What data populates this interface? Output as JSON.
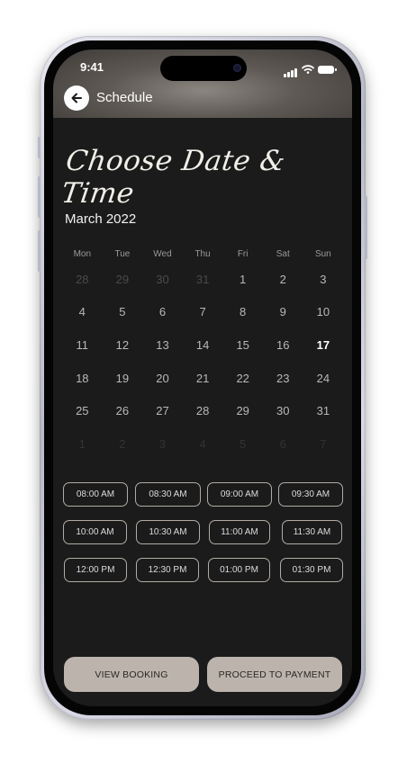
{
  "status_bar": {
    "time": "9:41"
  },
  "header": {
    "title": "Schedule",
    "back_icon": "arrow-left-icon"
  },
  "page_title": "Choose Date & Time",
  "calendar": {
    "month": "March 2022",
    "weekdays": [
      "Mon",
      "Tue",
      "Wed",
      "Thu",
      "Fri",
      "Sat",
      "Sun"
    ],
    "weeks": [
      [
        {
          "d": "28",
          "t": "muted"
        },
        {
          "d": "29",
          "t": "muted"
        },
        {
          "d": "30",
          "t": "muted"
        },
        {
          "d": "31",
          "t": "muted"
        },
        {
          "d": "1",
          "t": "day"
        },
        {
          "d": "2",
          "t": "day"
        },
        {
          "d": "3",
          "t": "day"
        }
      ],
      [
        {
          "d": "4",
          "t": "day"
        },
        {
          "d": "5",
          "t": "day"
        },
        {
          "d": "6",
          "t": "day"
        },
        {
          "d": "7",
          "t": "day"
        },
        {
          "d": "8",
          "t": "day"
        },
        {
          "d": "9",
          "t": "day"
        },
        {
          "d": "10",
          "t": "day"
        }
      ],
      [
        {
          "d": "11",
          "t": "day"
        },
        {
          "d": "12",
          "t": "day"
        },
        {
          "d": "13",
          "t": "day"
        },
        {
          "d": "14",
          "t": "day"
        },
        {
          "d": "15",
          "t": "day"
        },
        {
          "d": "16",
          "t": "day"
        },
        {
          "d": "17",
          "t": "today"
        }
      ],
      [
        {
          "d": "18",
          "t": "day"
        },
        {
          "d": "19",
          "t": "day"
        },
        {
          "d": "20",
          "t": "day"
        },
        {
          "d": "21",
          "t": "day"
        },
        {
          "d": "22",
          "t": "day"
        },
        {
          "d": "23",
          "t": "day"
        },
        {
          "d": "24",
          "t": "day"
        }
      ],
      [
        {
          "d": "25",
          "t": "day"
        },
        {
          "d": "26",
          "t": "day"
        },
        {
          "d": "27",
          "t": "day"
        },
        {
          "d": "28",
          "t": "day"
        },
        {
          "d": "29",
          "t": "day"
        },
        {
          "d": "30",
          "t": "day"
        },
        {
          "d": "31",
          "t": "day"
        }
      ],
      [
        {
          "d": "1",
          "t": "faint"
        },
        {
          "d": "2",
          "t": "faint"
        },
        {
          "d": "3",
          "t": "faint"
        },
        {
          "d": "4",
          "t": "faint"
        },
        {
          "d": "5",
          "t": "faint"
        },
        {
          "d": "6",
          "t": "faint"
        },
        {
          "d": "7",
          "t": "faint"
        }
      ]
    ]
  },
  "time_slots": [
    [
      "08:00 AM",
      "08:30 AM",
      "09:00 AM",
      "09:30 AM"
    ],
    [
      "10:00 AM",
      "10:30 AM",
      "11:00 AM",
      "11:30 AM"
    ],
    [
      "12:00 PM",
      "12:30 PM",
      "01:00 PM",
      "01:30 PM"
    ]
  ],
  "actions": {
    "view_booking": "VIEW BOOKING",
    "proceed": "PROCEED TO PAYMENT"
  },
  "colors": {
    "background": "#1b1b1b",
    "accent": "#bcb4ac",
    "slot_border": "#b2aba4"
  }
}
